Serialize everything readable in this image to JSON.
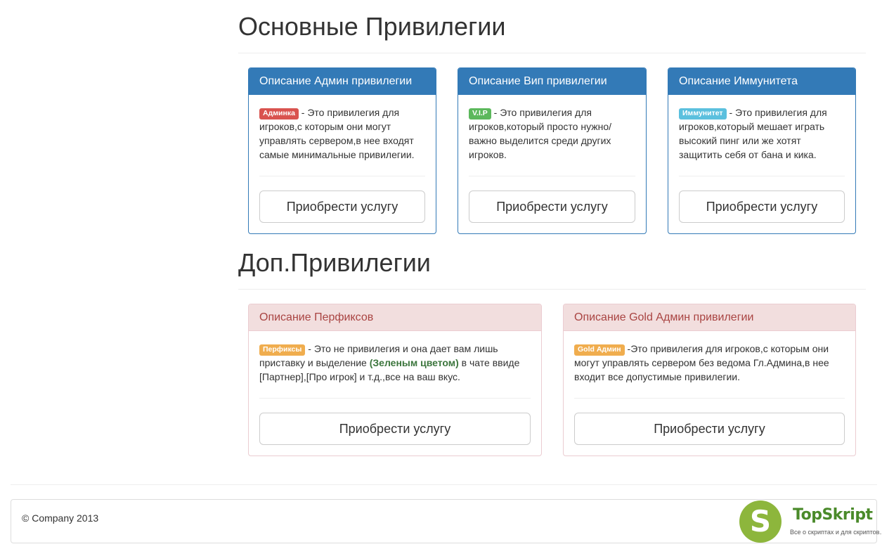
{
  "sections": {
    "main_title": "Основные Привилегии",
    "extra_title": "Доп.Привилегии"
  },
  "main_panels": [
    {
      "heading": "Описание Админ привилегии",
      "badge": "Админка",
      "text": " - Это привилегия для игроков,с которым они могут управлять сервером,в нее входят самые минимальные привилегии.",
      "button": "Приобрести услугу"
    },
    {
      "heading": "Описание Вип привилегии",
      "badge": "V.I.P",
      "text": " - Это привилегия для игроков,который просто нужно/важно выделится среди других игроков.",
      "button": "Приобрести услугу"
    },
    {
      "heading": "Описание Иммунитета",
      "badge": "Иммунитет",
      "text": " - Это привилегия для игроков,который мешает играть высокий пинг или же хотят защитить себя от бана и кика.",
      "button": "Приобрести услугу"
    }
  ],
  "extra_panels": [
    {
      "heading": "Описание Перфиксов",
      "badge": "Перфиксы",
      "text_before": " - Это не привилегия и она дает вам лишь приставку и выделение ",
      "highlight": "(Зеленым цветом)",
      "text_after": " в чате ввиде [Партнер],[Про игрок] и т.д.,все на ваш вкус.",
      "button": "Приобрести услугу"
    },
    {
      "heading": "Описание Gold Админ привилегии",
      "badge": "Gold Админ",
      "text": " -Это привилегия для игроков,с которым они могут управлять сервером без ведома Гл.Админа,в нее входит все допустимые привилегии.",
      "button": "Приобрести услугу"
    }
  ],
  "footer": {
    "copyright": "© Company 2013"
  },
  "watermark": {
    "letter": "S",
    "name": "TopSkript",
    "tagline": "Все о скриптах и для скриптов..."
  },
  "colors": {
    "primary": "#337ab7",
    "danger_bg": "#f2dede",
    "danger_text": "#a94442",
    "label_danger": "#d9534f",
    "label_success": "#5cb85c",
    "label_info": "#5bc0de",
    "label_warning": "#f0ad4e",
    "watermark_green": "#8db63c"
  }
}
